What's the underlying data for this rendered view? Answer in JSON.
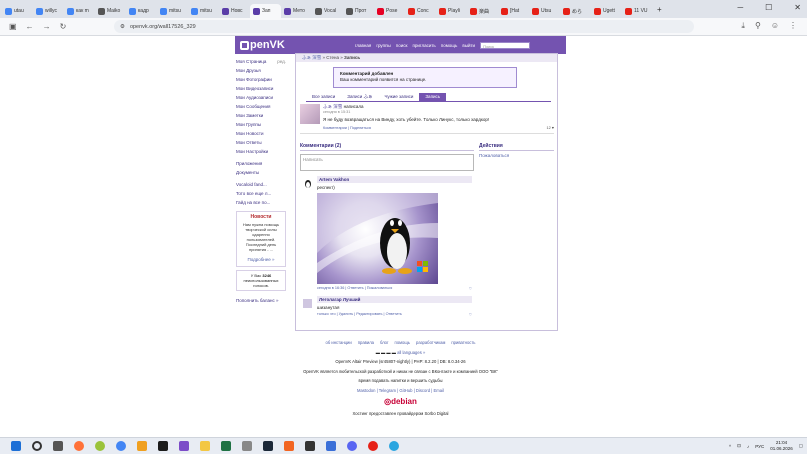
{
  "browser": {
    "tabs": [
      {
        "label": "utau",
        "color": "#4285f4"
      },
      {
        "label": "willyc",
        "color": "#4285f4"
      },
      {
        "label": "как m",
        "color": "#4285f4"
      },
      {
        "label": "Maiko",
        "color": "#555"
      },
      {
        "label": "кадр",
        "color": "#4285f4"
      },
      {
        "label": "mitsu",
        "color": "#4285f4"
      },
      {
        "label": "mitsu",
        "color": "#4285f4"
      },
      {
        "label": "Новс",
        "color": "#5a3da8"
      },
      {
        "label": "Зап",
        "color": "#5a3da8",
        "active": true
      },
      {
        "label": "Мето",
        "color": "#5a3da8"
      },
      {
        "label": "Vocal",
        "color": "#555"
      },
      {
        "label": "Прот",
        "color": "#555"
      },
      {
        "label": "Pose",
        "color": "#e60023"
      },
      {
        "label": "Conc",
        "color": "#e62117"
      },
      {
        "label": "Playli",
        "color": "#e62117"
      },
      {
        "label": "楽曲",
        "color": "#e62117"
      },
      {
        "label": "[Hat",
        "color": "#e62117"
      },
      {
        "label": "Utsu",
        "color": "#e62117"
      },
      {
        "label": "めら",
        "color": "#e62117"
      },
      {
        "label": "Ugett",
        "color": "#e62117"
      },
      {
        "label": "11 VU",
        "color": "#e62117"
      }
    ],
    "url": "openvk.org/wall17526_329"
  },
  "header": {
    "logo": "penVK",
    "nav": [
      "главная",
      "группы",
      "поиск",
      "пригласить",
      "помощь",
      "выйти"
    ],
    "search_placeholder": "Поиск"
  },
  "sidebar": {
    "items": [
      "Моя Страница",
      "Мои Друзья",
      "Мои Фотографии",
      "Мои Видеозаписи",
      "Мои Аудиозаписи",
      "Мои Сообщения",
      "Мои Заметки",
      "Мои Группы",
      "Мои Новости",
      "Мои Ответы",
      "Мои Настройки"
    ],
    "edit_label": "ред.",
    "items2": [
      "Приложения",
      "Документы"
    ],
    "items3": [
      "Vocaloid fand...",
      "Тото все еще л...",
      "Гайд на все по..."
    ],
    "news_title": "Новости",
    "news_text": "Нам нужна помощь творческой силы одаренно пользователей. Последний день принятия - ...",
    "news_more": "Подробнее »",
    "votes_text_prefix": "У Вас",
    "votes_count": "3246",
    "votes_text_suffix": "неиспользованных голосов.",
    "balance_link": "Пополнить баланс »"
  },
  "breadcrumb": {
    "user": "ふぁ 深雪",
    "sep1": "» Стена »",
    "current": "Запись"
  },
  "notice": {
    "title": "Комментарий добавлен",
    "text": "Ваш комментарий появится на странице."
  },
  "wall_tabs": [
    {
      "label": "Все записи",
      "active": false
    },
    {
      "label": "Записи ふぁ",
      "active": false
    },
    {
      "label": "Чужие записи",
      "active": false
    },
    {
      "label": "Запись",
      "active": true
    }
  ],
  "post": {
    "author": "ふぁ 深雪",
    "verb": "написала",
    "time": "сегодня в 15:31",
    "text": "Я не буду возвращаться на Винду, хоть убейте. Только Линукс, только хардкор!",
    "actions": "Комментарии | Поделиться",
    "likes": "12 ♥"
  },
  "comments": {
    "title": "Комментарии (2)",
    "placeholder": "Написать",
    "items": [
      {
        "author": "Artem Vakhon",
        "text": "респект)",
        "meta": "сегодня в 16:36 | Ответить | Пожаловаться",
        "like": "♡"
      },
      {
        "author": "Леголагар Лучший",
        "text": "шизанутая",
        "meta": "только что | Удалить | Редактировать | Ответить",
        "like": "♡"
      }
    ]
  },
  "actions": {
    "title": "Действия",
    "complain": "Пожаловаться"
  },
  "footer": {
    "links": [
      "об инстанции",
      "правила",
      "блог",
      "помощь",
      "разработчикам",
      "приватность"
    ],
    "languages": "all languages »",
    "version": "OpenVK Altair Preview (sr45807-nightly) | PHP: 8.2.20 | DB: 8.0.34-26",
    "disclaimer": "OpenVK является любительской разработкой и никак не связан с ВКонтакте и компанией ООО \"ВК\"",
    "slogan": "время подавать напитки и вершить судьбы",
    "social": "Mastodon | Telegram | GitHub | Discord | Email",
    "debian": "debian",
    "hosting": "Хостинг предоставлен провайдером Sorbo Digital"
  },
  "taskbar": {
    "lang": "РУС",
    "time": "21:04",
    "date": "01.06.2026"
  }
}
